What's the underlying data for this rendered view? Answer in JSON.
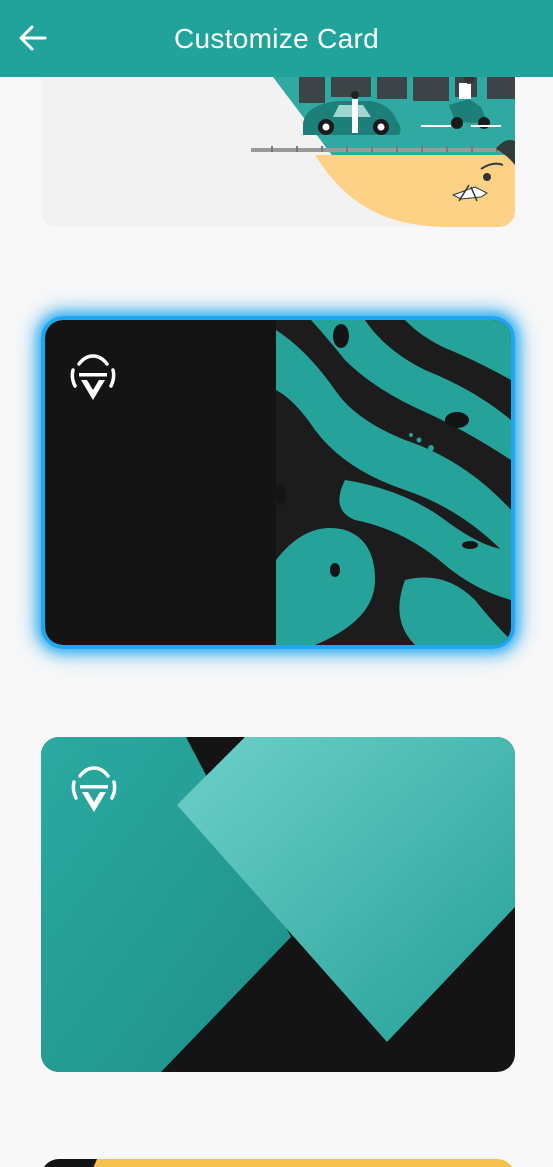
{
  "header": {
    "title": "Customize Card",
    "back_icon": "arrow-left-icon"
  },
  "colors": {
    "app_bar": "#21a39b",
    "selection_border": "#1ea6f0",
    "teal": "#25a39a",
    "dark": "#141414",
    "sand": "#fdd286"
  },
  "cards": [
    {
      "design": "city-beach-illustration",
      "selected": false
    },
    {
      "design": "teal-swirl-pattern",
      "selected": true
    },
    {
      "design": "teal-diamond-geometric",
      "selected": false
    },
    {
      "design": "gold-dark",
      "selected": false
    }
  ]
}
